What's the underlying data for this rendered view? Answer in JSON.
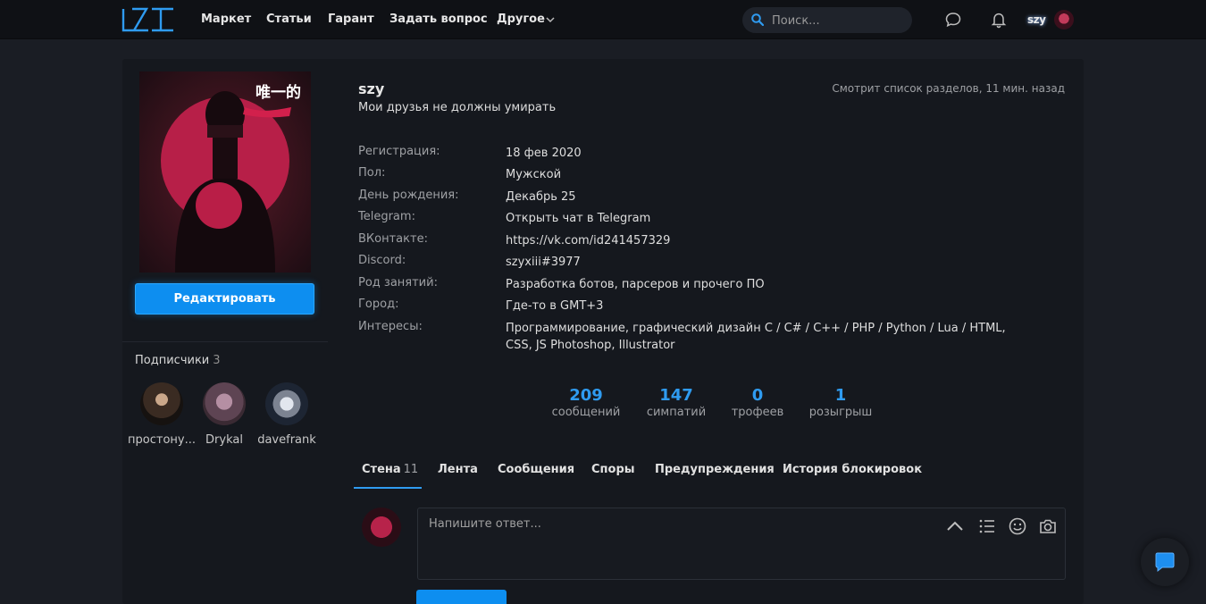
{
  "header": {
    "nav": [
      "Маркет",
      "Статьи",
      "Гарант",
      "Задать вопрос",
      "Другое"
    ],
    "search_placeholder": "Поиск...",
    "username": "szy",
    "icons": [
      "logo-lzt",
      "chevron-down-icon",
      "search-icon",
      "chat-bubble-icon",
      "bell-icon",
      "avatar"
    ]
  },
  "sidebar": {
    "avatar_text": "唯一的",
    "edit_label": "Редактировать",
    "followers_title": "Подписчики",
    "followers_count": "3",
    "followers": [
      {
        "name": "простону..."
      },
      {
        "name": "Drykal"
      },
      {
        "name": "davefrank"
      }
    ]
  },
  "profile": {
    "username": "szy",
    "status": "Мои друзья не должны умирать",
    "activity": "Смотрит список разделов, 11 мин. назад",
    "info": [
      {
        "label": "Регистрация:",
        "value": "18 фев 2020"
      },
      {
        "label": "Пол:",
        "value": "Мужской"
      },
      {
        "label": "День рождения:",
        "value": "Декабрь 25"
      },
      {
        "label": "Telegram:",
        "value": "Открыть чат в Telegram"
      },
      {
        "label": "ВКонтакте:",
        "value": "https://vk.com/id241457329"
      },
      {
        "label": "Discord:",
        "value": "szyxiii#3977"
      },
      {
        "label": "Род занятий:",
        "value": "Разработка ботов, парсеров и прочего ПО"
      },
      {
        "label": "Город:",
        "value": "Где-то в GMT+3"
      },
      {
        "label": "Интересы:",
        "value": "Программирование, графический дизайн C / C# / C++ / PHP / Python / Lua / HTML, CSS, JS Photoshop, Illustrator"
      }
    ],
    "stats": [
      {
        "value": "209",
        "label": "сообщений"
      },
      {
        "value": "147",
        "label": "симпатий"
      },
      {
        "value": "0",
        "label": "трофеев"
      },
      {
        "value": "1",
        "label": "розыгрыш"
      }
    ],
    "tabs": [
      {
        "label": "Стена",
        "count": "11"
      },
      {
        "label": "Лента"
      },
      {
        "label": "Сообщения"
      },
      {
        "label": "Споры"
      },
      {
        "label": "Предупреждения"
      },
      {
        "label": "История блокировок"
      }
    ],
    "reply_placeholder": "Напишите ответ...",
    "reply_icons": [
      "chevron-up-icon",
      "list-icon",
      "smile-icon",
      "camera-icon"
    ]
  },
  "colors": {
    "accent": "#2f9bf0",
    "button": "#0d8ef0",
    "background": "#1a1d24",
    "card": "#15181e",
    "topbar": "#0f1115"
  }
}
